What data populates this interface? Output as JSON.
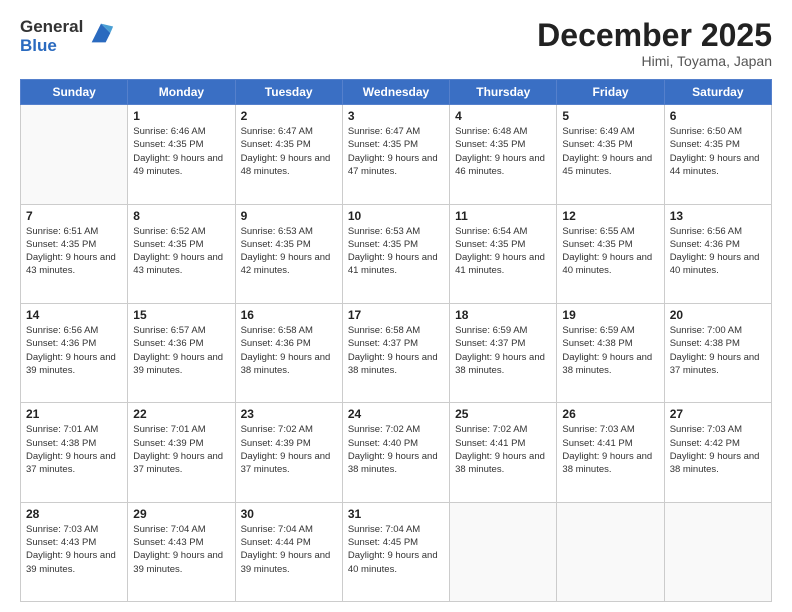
{
  "logo": {
    "general": "General",
    "blue": "Blue"
  },
  "header": {
    "month": "December 2025",
    "location": "Himi, Toyama, Japan"
  },
  "weekdays": [
    "Sunday",
    "Monday",
    "Tuesday",
    "Wednesday",
    "Thursday",
    "Friday",
    "Saturday"
  ],
  "weeks": [
    [
      {
        "day": "",
        "empty": true
      },
      {
        "day": "1",
        "sunrise": "6:46 AM",
        "sunset": "4:35 PM",
        "daylight": "9 hours and 49 minutes."
      },
      {
        "day": "2",
        "sunrise": "6:47 AM",
        "sunset": "4:35 PM",
        "daylight": "9 hours and 48 minutes."
      },
      {
        "day": "3",
        "sunrise": "6:47 AM",
        "sunset": "4:35 PM",
        "daylight": "9 hours and 47 minutes."
      },
      {
        "day": "4",
        "sunrise": "6:48 AM",
        "sunset": "4:35 PM",
        "daylight": "9 hours and 46 minutes."
      },
      {
        "day": "5",
        "sunrise": "6:49 AM",
        "sunset": "4:35 PM",
        "daylight": "9 hours and 45 minutes."
      },
      {
        "day": "6",
        "sunrise": "6:50 AM",
        "sunset": "4:35 PM",
        "daylight": "9 hours and 44 minutes."
      }
    ],
    [
      {
        "day": "7",
        "sunrise": "6:51 AM",
        "sunset": "4:35 PM",
        "daylight": "9 hours and 43 minutes."
      },
      {
        "day": "8",
        "sunrise": "6:52 AM",
        "sunset": "4:35 PM",
        "daylight": "9 hours and 43 minutes."
      },
      {
        "day": "9",
        "sunrise": "6:53 AM",
        "sunset": "4:35 PM",
        "daylight": "9 hours and 42 minutes."
      },
      {
        "day": "10",
        "sunrise": "6:53 AM",
        "sunset": "4:35 PM",
        "daylight": "9 hours and 41 minutes."
      },
      {
        "day": "11",
        "sunrise": "6:54 AM",
        "sunset": "4:35 PM",
        "daylight": "9 hours and 41 minutes."
      },
      {
        "day": "12",
        "sunrise": "6:55 AM",
        "sunset": "4:35 PM",
        "daylight": "9 hours and 40 minutes."
      },
      {
        "day": "13",
        "sunrise": "6:56 AM",
        "sunset": "4:36 PM",
        "daylight": "9 hours and 40 minutes."
      }
    ],
    [
      {
        "day": "14",
        "sunrise": "6:56 AM",
        "sunset": "4:36 PM",
        "daylight": "9 hours and 39 minutes."
      },
      {
        "day": "15",
        "sunrise": "6:57 AM",
        "sunset": "4:36 PM",
        "daylight": "9 hours and 39 minutes."
      },
      {
        "day": "16",
        "sunrise": "6:58 AM",
        "sunset": "4:36 PM",
        "daylight": "9 hours and 38 minutes."
      },
      {
        "day": "17",
        "sunrise": "6:58 AM",
        "sunset": "4:37 PM",
        "daylight": "9 hours and 38 minutes."
      },
      {
        "day": "18",
        "sunrise": "6:59 AM",
        "sunset": "4:37 PM",
        "daylight": "9 hours and 38 minutes."
      },
      {
        "day": "19",
        "sunrise": "6:59 AM",
        "sunset": "4:38 PM",
        "daylight": "9 hours and 38 minutes."
      },
      {
        "day": "20",
        "sunrise": "7:00 AM",
        "sunset": "4:38 PM",
        "daylight": "9 hours and 37 minutes."
      }
    ],
    [
      {
        "day": "21",
        "sunrise": "7:01 AM",
        "sunset": "4:38 PM",
        "daylight": "9 hours and 37 minutes."
      },
      {
        "day": "22",
        "sunrise": "7:01 AM",
        "sunset": "4:39 PM",
        "daylight": "9 hours and 37 minutes."
      },
      {
        "day": "23",
        "sunrise": "7:02 AM",
        "sunset": "4:39 PM",
        "daylight": "9 hours and 37 minutes."
      },
      {
        "day": "24",
        "sunrise": "7:02 AM",
        "sunset": "4:40 PM",
        "daylight": "9 hours and 38 minutes."
      },
      {
        "day": "25",
        "sunrise": "7:02 AM",
        "sunset": "4:41 PM",
        "daylight": "9 hours and 38 minutes."
      },
      {
        "day": "26",
        "sunrise": "7:03 AM",
        "sunset": "4:41 PM",
        "daylight": "9 hours and 38 minutes."
      },
      {
        "day": "27",
        "sunrise": "7:03 AM",
        "sunset": "4:42 PM",
        "daylight": "9 hours and 38 minutes."
      }
    ],
    [
      {
        "day": "28",
        "sunrise": "7:03 AM",
        "sunset": "4:43 PM",
        "daylight": "9 hours and 39 minutes."
      },
      {
        "day": "29",
        "sunrise": "7:04 AM",
        "sunset": "4:43 PM",
        "daylight": "9 hours and 39 minutes."
      },
      {
        "day": "30",
        "sunrise": "7:04 AM",
        "sunset": "4:44 PM",
        "daylight": "9 hours and 39 minutes."
      },
      {
        "day": "31",
        "sunrise": "7:04 AM",
        "sunset": "4:45 PM",
        "daylight": "9 hours and 40 minutes."
      },
      {
        "day": "",
        "empty": true
      },
      {
        "day": "",
        "empty": true
      },
      {
        "day": "",
        "empty": true
      }
    ]
  ]
}
